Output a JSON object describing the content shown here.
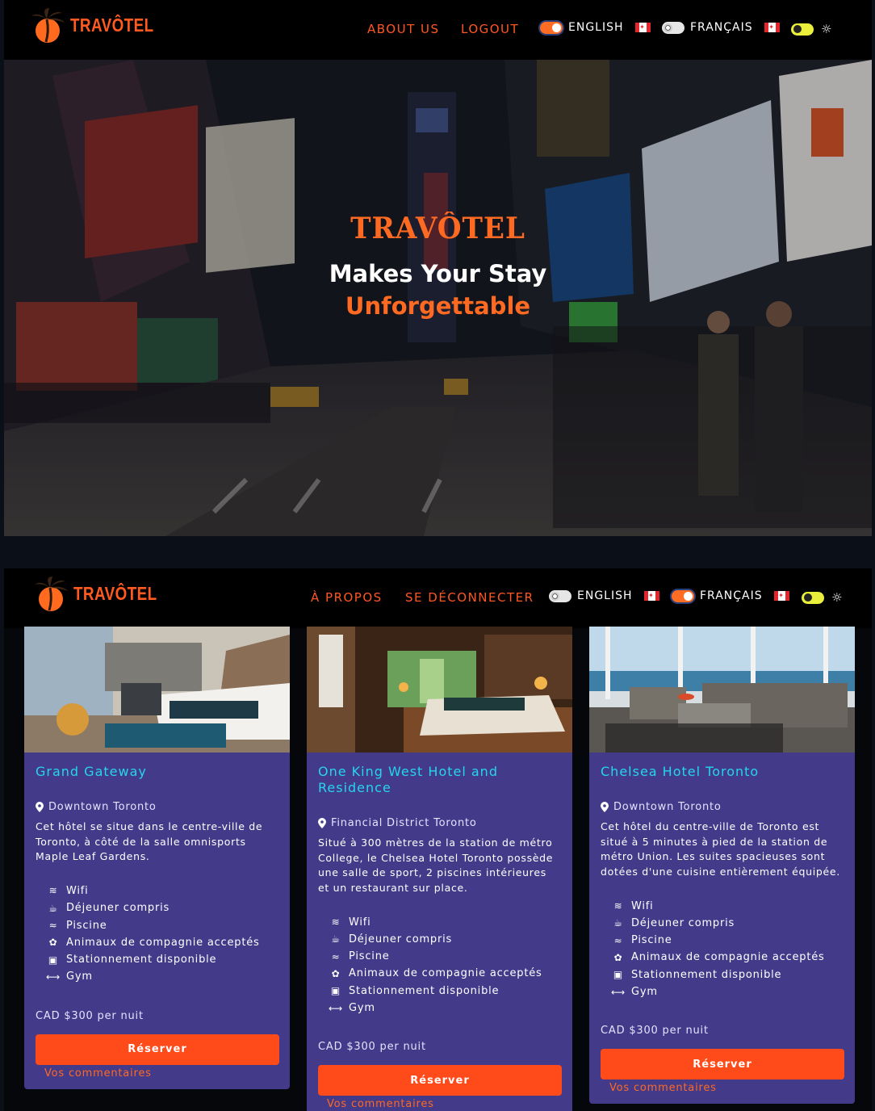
{
  "top": {
    "brand": "TRAVÔTEL",
    "nav": {
      "about": "ABOUT US",
      "logout": "LOGOUT"
    },
    "lang": {
      "english": "ENGLISH",
      "french": "FRANÇAIS",
      "active": "english"
    },
    "hero": {
      "brand": "TRAVÔTEL",
      "line1": "Makes Your Stay",
      "line2": "Unforgettable"
    }
  },
  "bottom": {
    "brand": "TRAVÔTEL",
    "nav": {
      "about": "À PROPOS",
      "logout": "SE DÉCONNECTER"
    },
    "lang": {
      "english": "ENGLISH",
      "french": "FRANÇAIS",
      "active": "french"
    }
  },
  "cards": [
    {
      "title": "Grand Gateway",
      "location": "Downtown Toronto",
      "description": "Cet hôtel se situe dans le centre-ville de Toronto, à côté de la salle omnisports Maple Leaf Gardens.",
      "amenities": [
        "Wifi",
        "Déjeuner compris",
        "Piscine",
        "Animaux de compagnie acceptés",
        "Stationnement disponible",
        "Gym"
      ],
      "price": "CAD $300 per nuit",
      "reserve": "Réserver",
      "comments": "Vos commentaires"
    },
    {
      "title": "One King West Hotel and Residence",
      "location": "Financial District Toronto",
      "description": "Situé à 300 mètres de la station de métro College, le Chelsea Hotel Toronto possède une salle de sport, 2 piscines intérieures et un restaurant sur place.",
      "amenities": [
        "Wifi",
        "Déjeuner compris",
        "Piscine",
        "Animaux de compagnie acceptés",
        "Stationnement disponible",
        "Gym"
      ],
      "price": "CAD $300 per nuit",
      "reserve": "Réserver",
      "comments": "Vos commentaires"
    },
    {
      "title": "Chelsea Hotel Toronto",
      "location": "Downtown Toronto",
      "description": "Cet hôtel du centre-ville de Toronto est situé à 5 minutes à pied de la station de métro Union. Les suites spacieuses sont dotées d'une cuisine entièrement équipée.",
      "amenities": [
        "Wifi",
        "Déjeuner compris",
        "Piscine",
        "Animaux de compagnie acceptés",
        "Stationnement disponible",
        "Gym"
      ],
      "price": "CAD $300 per nuit",
      "reserve": "Réserver",
      "comments": "Vos commentaires"
    }
  ],
  "colors": {
    "accent": "#ff5722",
    "card": "#433a8a",
    "title": "#25d5ee",
    "button": "#ff4a1a"
  }
}
